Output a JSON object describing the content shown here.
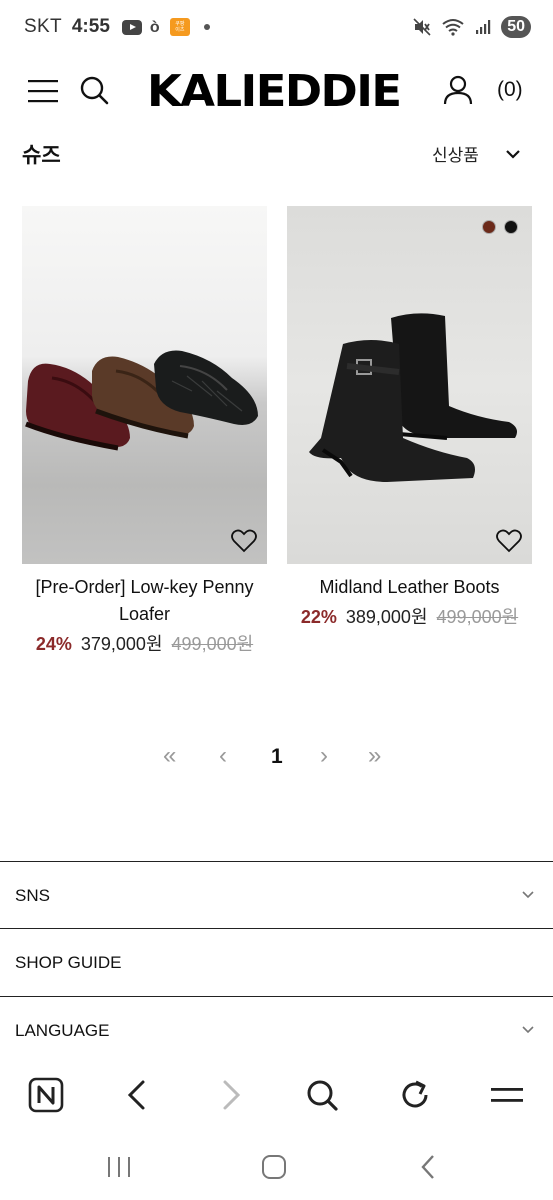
{
  "status": {
    "carrier": "SKT",
    "time": "4:55",
    "battery": "50",
    "app_badge_text": "쿠팡\n이츠"
  },
  "header": {
    "logo": "KALIEDDIE",
    "cart_count": "(0)"
  },
  "category": {
    "title": "슈즈",
    "sort": "신상품"
  },
  "products": [
    {
      "name": "[Pre-Order] Low-key Penny Loafer",
      "discount": "24%",
      "price": "379,000원",
      "original_price": "499,000원"
    },
    {
      "name": "Midland Leather Boots",
      "discount": "22%",
      "price": "389,000원",
      "original_price": "499,000원",
      "colors": [
        "#6b2a1a",
        "#111111"
      ]
    }
  ],
  "pagination": {
    "first": "«",
    "prev": "‹",
    "current": "1",
    "next": "›",
    "last": "»"
  },
  "footer": {
    "sns": "SNS",
    "shop_guide": "SHOP GUIDE",
    "language": "LANGUAGE"
  },
  "icons": {
    "browser_home": "naver-n-icon",
    "browser_back": "back-arrow-icon",
    "browser_forward": "forward-arrow-icon",
    "browser_search": "search-icon",
    "browser_refresh": "refresh-icon",
    "browser_menu": "menu-icon"
  }
}
